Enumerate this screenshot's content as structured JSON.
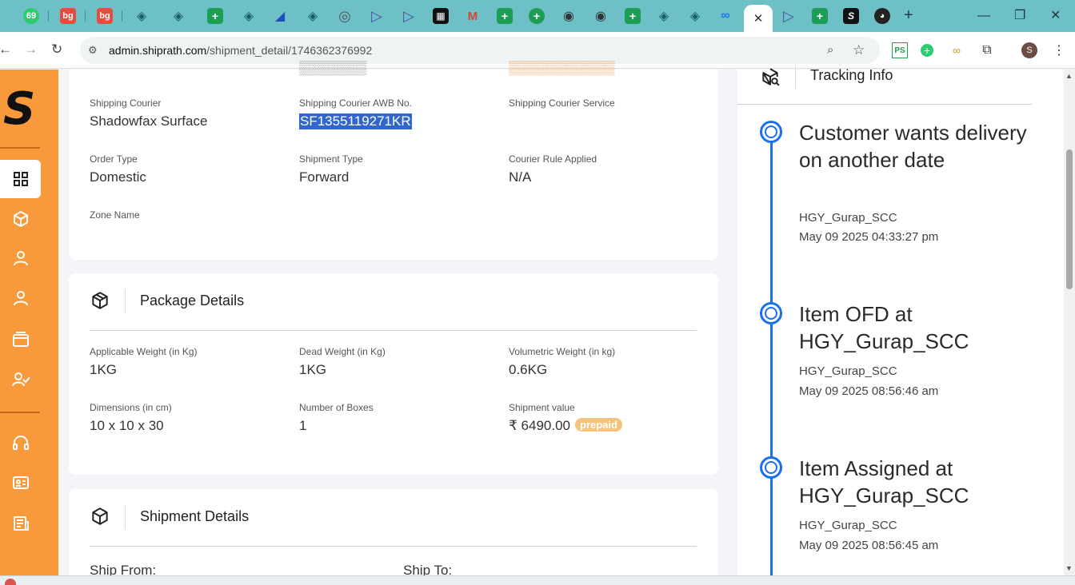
{
  "browser": {
    "url_host": "admin.shiprath.com",
    "url_path": "/shipment_detail/1746362376992",
    "tab_badge": "69",
    "profile_initial": "S",
    "extension_label": "PS"
  },
  "colors": {
    "sidebar": "#f89a3c",
    "accent": "#1a6ff0",
    "badge": "#f5c27a",
    "tabstrip": "#6ec0c7"
  },
  "courier": {
    "shipping_courier_label": "Shipping Courier",
    "shipping_courier_value": "Shadowfax Surface",
    "awb_label": "Shipping Courier AWB No.",
    "awb_value": "SF1355119271KR",
    "service_label": "Shipping Courier Service",
    "service_value": "",
    "order_type_label": "Order Type",
    "order_type_value": "Domestic",
    "shipment_type_label": "Shipment Type",
    "shipment_type_value": "Forward",
    "courier_rule_label": "Courier Rule Applied",
    "courier_rule_value": "N/A",
    "zone_label": "Zone Name",
    "zone_value": ""
  },
  "package": {
    "title": "Package Details",
    "applicable_weight_label": "Applicable Weight (in Kg)",
    "applicable_weight_value": "1KG",
    "dead_weight_label": "Dead Weight (in Kg)",
    "dead_weight_value": "1KG",
    "volumetric_weight_label": "Volumetric Weight (in kg)",
    "volumetric_weight_value": "0.6KG",
    "dimensions_label": "Dimensions (in cm)",
    "dimensions_value": "10 x 10 x 30",
    "boxes_label": "Number of Boxes",
    "boxes_value": "1",
    "shipment_value_label": "Shipment value",
    "shipment_value": "₹ 6490.00",
    "payment_badge": "prepaid"
  },
  "shipment": {
    "title": "Shipment Details",
    "ship_from_label": "Ship From:",
    "ship_to_label": "Ship To:"
  },
  "tracking": {
    "title": "Tracking Info",
    "events": [
      {
        "title": "Customer wants delivery on another date",
        "location": "HGY_Gurap_SCC",
        "time": "May 09 2025 04:33:27 pm"
      },
      {
        "title": "Item OFD at HGY_Gurap_SCC",
        "location": "HGY_Gurap_SCC",
        "time": "May 09 2025 08:56:46 am"
      },
      {
        "title": "Item Assigned at HGY_Gurap_SCC",
        "location": "HGY_Gurap_SCC",
        "time": "May 09 2025 08:56:45 am"
      }
    ]
  },
  "icons": {
    "close": "✕",
    "plus": "+",
    "minimize": "—",
    "restore": "❐",
    "window_close": "✕",
    "back": "←",
    "forward": "→",
    "reload": "↻",
    "zoom": "⌕",
    "star": "☆",
    "puzzle": "⧉",
    "menu": "⋮",
    "tune": "⚙",
    "scroll_up": "▲",
    "scroll_down": "▼"
  }
}
